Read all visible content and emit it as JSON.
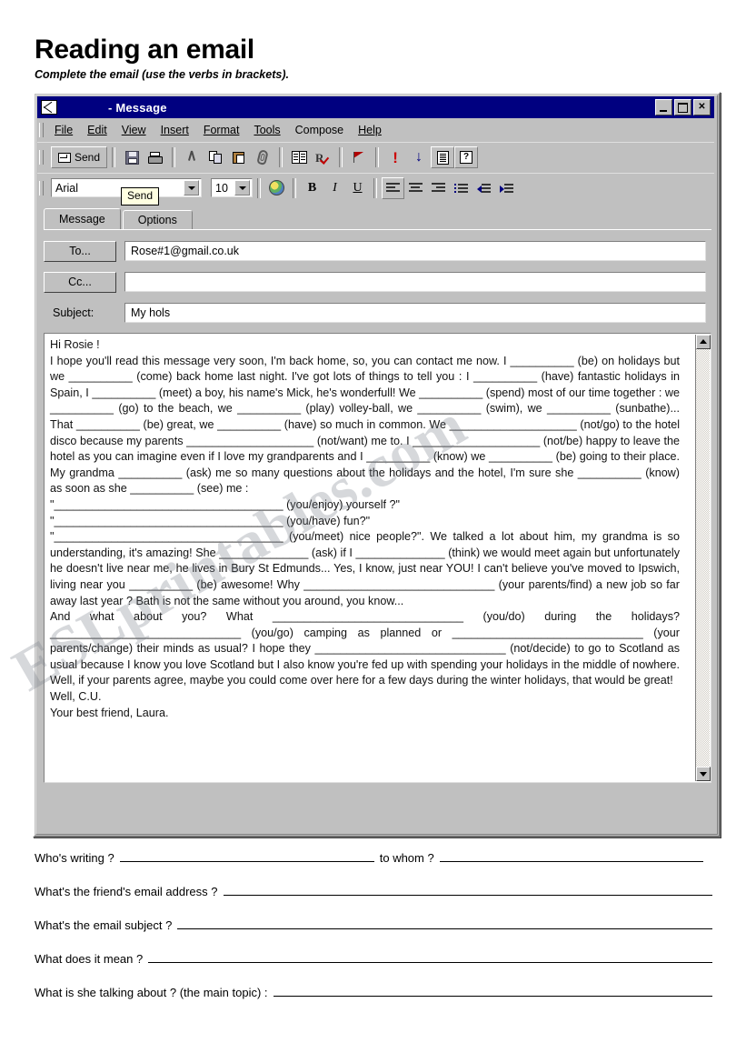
{
  "worksheet": {
    "title": "Reading an email",
    "subtitle": "Complete the email (use the verbs in brackets)."
  },
  "watermark": "ESLprintables.com",
  "window": {
    "title_suffix": "- Message",
    "controls": {
      "minimize": "_",
      "maximize": "□",
      "close": "✕"
    },
    "menus": [
      {
        "label": "File"
      },
      {
        "label": "Edit"
      },
      {
        "label": "View"
      },
      {
        "label": "Insert"
      },
      {
        "label": "Format"
      },
      {
        "label": "Tools"
      },
      {
        "label": "Compose"
      },
      {
        "label": "Help"
      }
    ],
    "toolbar": {
      "send_label": "Send",
      "tooltip": "Send",
      "icons": [
        "save-icon",
        "print-icon",
        "cut-icon",
        "copy-icon",
        "paste-icon",
        "attach-icon",
        "address-book-icon",
        "check-names-icon",
        "flag-icon",
        "high-priority-icon",
        "low-priority-icon",
        "options-icon",
        "help-icon"
      ]
    },
    "format_bar": {
      "font_name": "Arial",
      "font_size": "10",
      "bold": "B",
      "italic": "I",
      "underline": "U"
    },
    "tabs": [
      {
        "label": "Message",
        "active": true
      },
      {
        "label": "Options",
        "active": false
      }
    ],
    "fields": {
      "to_label": "To...",
      "to_value": "Rose#1@gmail.co.uk",
      "cc_label": "Cc...",
      "cc_value": "",
      "subject_label": "Subject:",
      "subject_value": "My hols"
    }
  },
  "email_body": {
    "greeting": "Hi Rosie !",
    "paragraph_1": "I hope you'll read this message very soon, I'm back home, so, you can contact me now. I __________ (be) on holidays but we __________ (come) back home last night. I've got lots of things to tell you : I __________ (have) fantastic holidays in Spain, I __________ (meet) a boy, his name's Mick, he's wonderfull! We __________ (spend) most of our time together : we __________ (go) to the beach, we __________ (play) volley-ball, we __________ (swim), we __________ (sunbathe)... That __________ (be) great, we __________ (have) so much in common. We ____________________ (not/go) to the hotel disco because my parents ____________________ (not/want) me to. I ____________________ (not/be) happy to leave the hotel as you can imagine even if I love my grandparents and I __________ (know) we __________ (be) going to their place. My grandma __________ (ask) me so many questions about the holidays and the hotel, I'm sure she __________ (know) as soon as she __________ (see) me :",
    "quote_1": "\"____________________________________ (you/enjoy) yourself ?\"",
    "quote_2": "\"____________________________________ (you/have) fun?\"",
    "quote_3": "\"____________________________________ (you/meet) nice people?\". We talked a lot about him, my grandma is so understanding, it's amazing! She ______________ (ask) if I ______________ (think) we would meet again but unfortunately he doesn't live near me, he lives in Bury St Edmunds... Yes, I know, just near YOU! I can't believe you've moved to Ipswich, living near you __________ (be) awesome! Why ______________________________ (your parents/find) a new job so far away last year ? Bath is not the same without you around, you know...",
    "paragraph_2": "And what about you? What ______________________________ (you/do) during the holidays? ______________________________ (you/go) camping as planned or ______________________________ (your parents/change) their minds as usual? I hope they ______________________________ (not/decide) to go to Scotland as usual because I know you love Scotland but I also know you're fed up with spending your holidays in the middle of nowhere. Well, if your parents agree, maybe you could come over here for a few days during the winter holidays, that would be great!",
    "signoff_1": "Well, C.U.",
    "signoff_2": "Your best friend, Laura."
  },
  "questions": [
    {
      "label": "Who's writing ?",
      "label2": "to whom ?"
    },
    {
      "label": "What's the friend's email address ?"
    },
    {
      "label": "What's the email subject ?"
    },
    {
      "label": "What does it mean ?"
    },
    {
      "label": "What is she talking about ? (the main topic) :"
    }
  ]
}
